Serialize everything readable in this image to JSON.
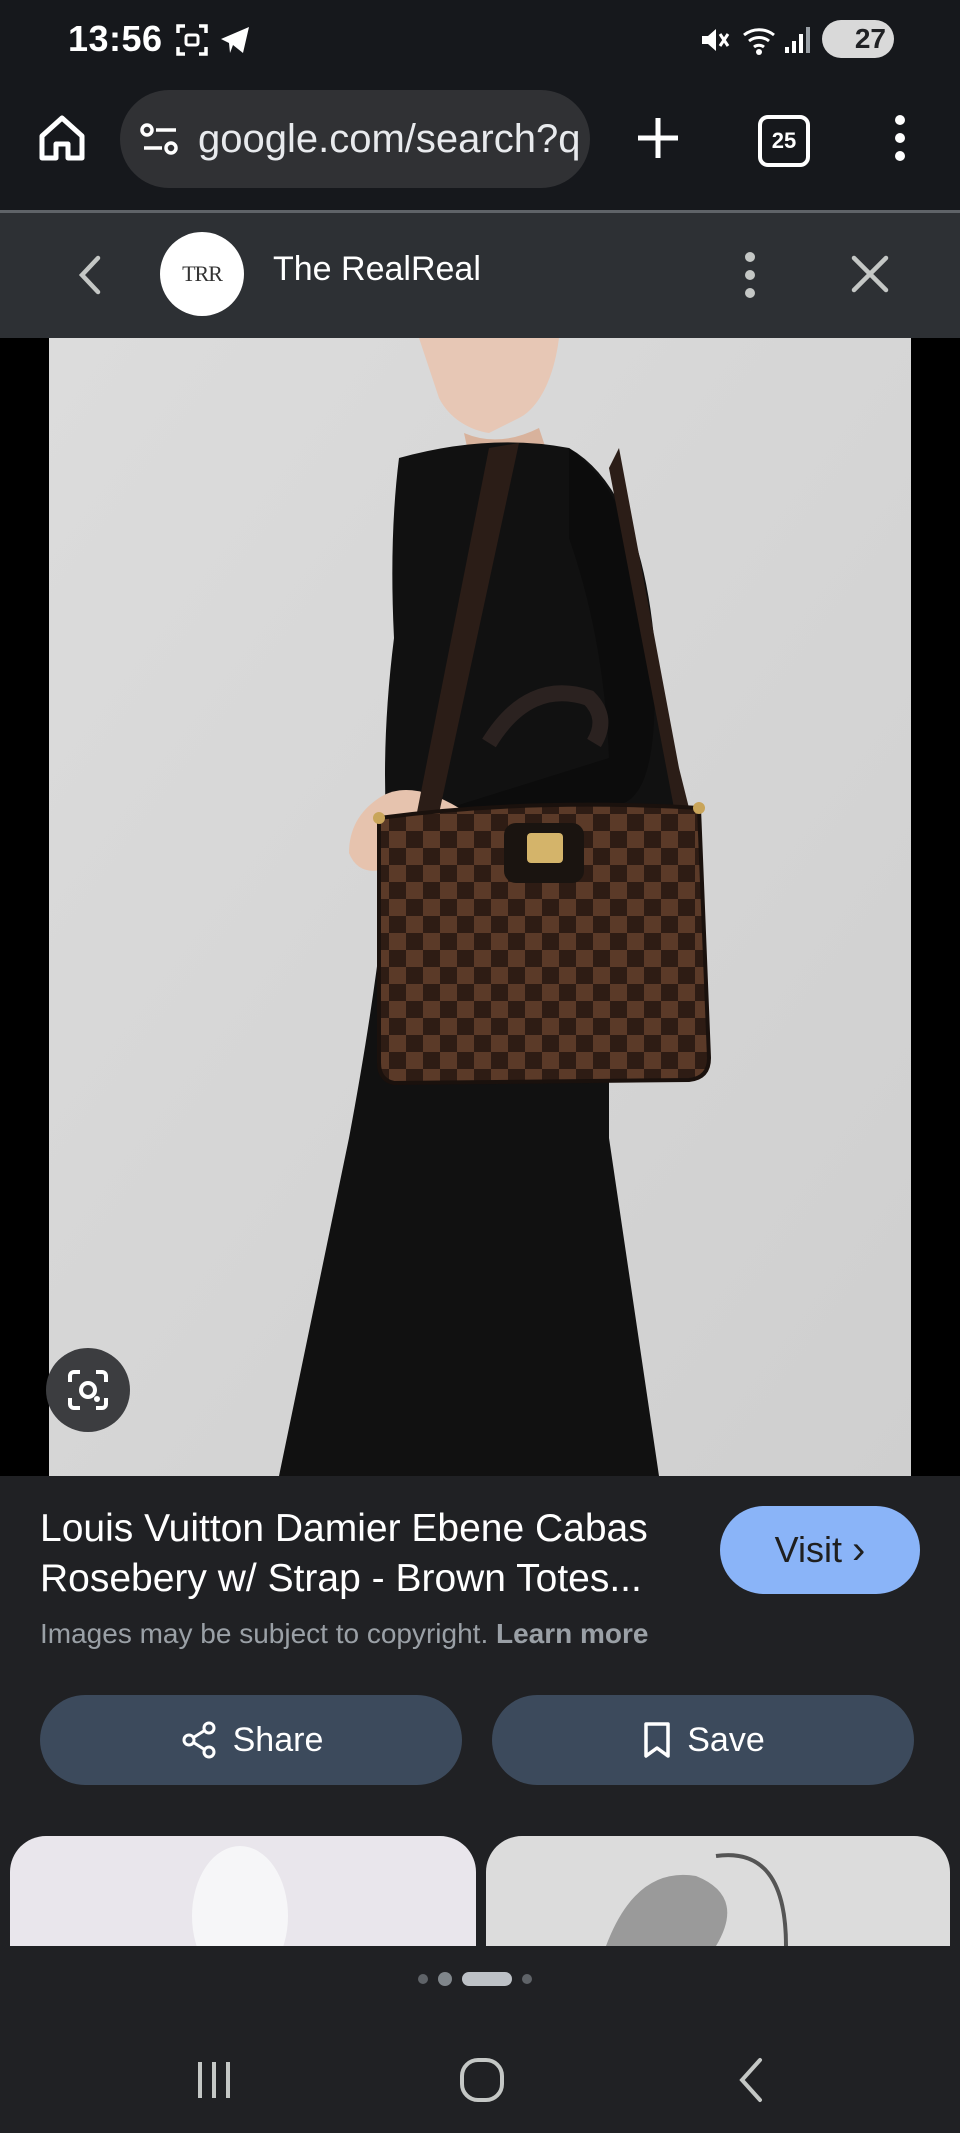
{
  "status_bar": {
    "time": "13:56",
    "battery": "27",
    "icons": [
      "screenshot-icon",
      "telegram-icon",
      "mute-icon",
      "wifi-icon",
      "signal-icon",
      "battery-icon"
    ]
  },
  "browser": {
    "url": "google.com/search?q",
    "tab_count": "25"
  },
  "source": {
    "logo_text": "TRR",
    "name": "The RealReal"
  },
  "result": {
    "title": "Louis Vuitton Damier Ebene Cabas Rosebery w/ Strap - Brown Totes...",
    "visit_label": "Visit",
    "visit_chevron": "›",
    "copyright_text": "Images may be subject to copyright.",
    "learn_more": "Learn more",
    "share_label": "Share",
    "save_label": "Save"
  },
  "colors": {
    "accent": "#8ab4f8",
    "pill_button": "#3c4a5c",
    "background": "#202124"
  }
}
